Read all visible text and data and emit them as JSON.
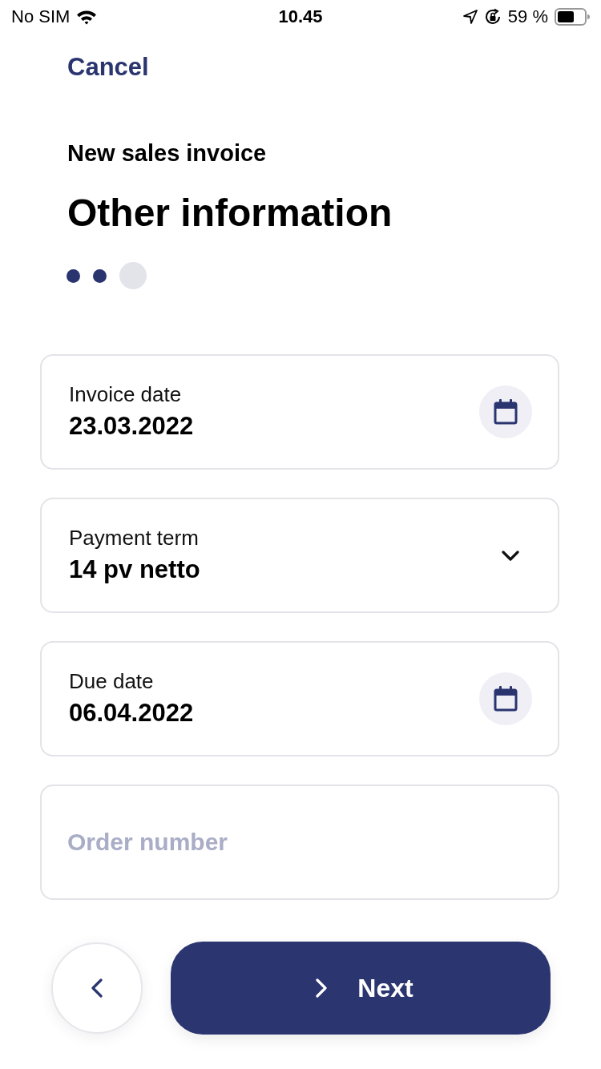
{
  "status_bar": {
    "carrier": "No SIM",
    "time": "10.45",
    "battery_percent": "59 %"
  },
  "cancel": "Cancel",
  "header": {
    "subtitle": "New sales invoice",
    "title": "Other information"
  },
  "steps": [
    {
      "completed": true
    },
    {
      "completed": true
    },
    {
      "completed": false
    }
  ],
  "fields": [
    {
      "kind": "date",
      "label": "Invoice date",
      "value": "23.03.2022"
    },
    {
      "kind": "select",
      "label": "Payment term",
      "value": "14 pv netto"
    },
    {
      "kind": "date",
      "label": "Due date",
      "value": "06.04.2022"
    },
    {
      "kind": "text",
      "placeholder": "Order number"
    }
  ],
  "footer": {
    "next": "Next"
  }
}
